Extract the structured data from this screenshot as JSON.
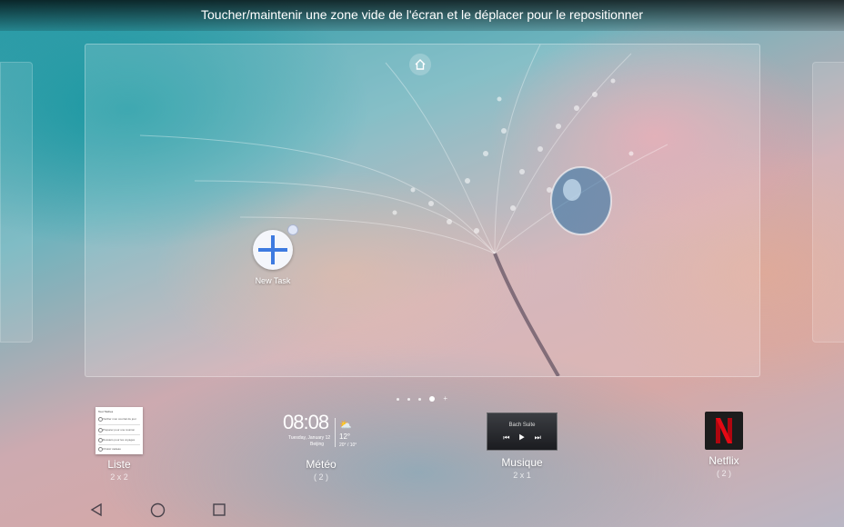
{
  "hint": "Toucher/maintenir une zone vide de l'écran et le déplacer pour le repositionner",
  "home_icon": "home-icon",
  "app": {
    "label": "New Task",
    "icon": "plus-icon"
  },
  "pager": {
    "count": 4,
    "active_index": 3,
    "plus_icon": "add-page-icon"
  },
  "widgets": [
    {
      "name": "Liste",
      "size": "2 x 2",
      "preview": {
        "title": "Tout Tâches",
        "items": [
          "Vérifier mon courriel du jour",
          "Préparer pour une réunion",
          "Dossiers pour les voyages",
          "Choisir cadeau"
        ]
      }
    },
    {
      "name": "Météo",
      "size": "( 2 )",
      "preview": {
        "time": "08:08",
        "date": "Tuesday, January 12",
        "city": "Beijing",
        "temp": "12°",
        "range": "20° / 10°",
        "icon": "partly-cloudy-icon"
      }
    },
    {
      "name": "Musique",
      "size": "2 x 1",
      "preview": {
        "track": "Bach Suite",
        "controls": [
          "previous-icon",
          "play-icon",
          "next-icon"
        ]
      }
    },
    {
      "name": "Netflix",
      "size": "( 2 )",
      "preview": {
        "logo": "N",
        "logo_color": "#e50914"
      }
    }
  ],
  "nav": {
    "back": "back-icon",
    "home": "home-circle-icon",
    "recents": "recents-icon"
  }
}
